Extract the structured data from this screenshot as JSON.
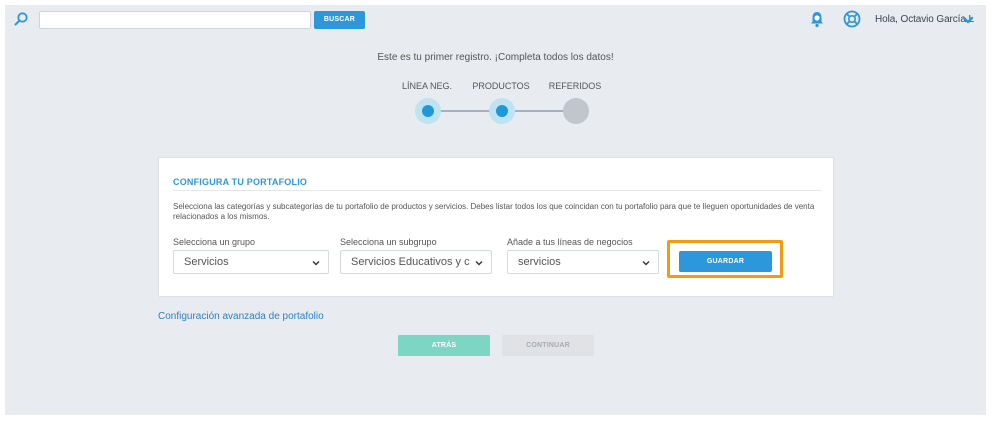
{
  "topbar": {
    "search_placeholder": "",
    "search_button": "BUSCAR",
    "greeting": "Hola, Octavio García L",
    "icons": [
      "search-icon",
      "bell-icon",
      "help-icon",
      "chevron-down-icon"
    ]
  },
  "stepper": {
    "intro": "Este es tu primer registro. ¡Completa todos los datos!",
    "steps": [
      {
        "label": "LÍNEA NEG.",
        "state": "active"
      },
      {
        "label": "PRODUCTOS",
        "state": "active"
      },
      {
        "label": "REFERIDOS",
        "state": "inactive"
      }
    ]
  },
  "panel": {
    "title": "CONFIGURA TU PORTAFOLIO",
    "description": "Selecciona las categorías y subcategorías de tu portafolio de productos y servicios. Debes listar todos los que coincidan con tu portafolio para que te lleguen oportunidades de venta relacionados a los mismos.",
    "fields": [
      {
        "label": "Selecciona un grupo",
        "value": "Servicios"
      },
      {
        "label": "Selecciona un subgrupo",
        "value": "Servicios Educativos y c"
      },
      {
        "label": "Añade a tus líneas de negocios",
        "value": "servicios"
      }
    ],
    "save_button": "GUARDAR"
  },
  "advanced_link": "Configuración avanzada de portafolio",
  "nav": {
    "back": "ATRÁS",
    "continue": "CONTINUAR"
  },
  "colors": {
    "accent": "#2d97dc",
    "highlight": "#f39a14",
    "back_button": "#7dd5c4",
    "background": "#e8ebf0"
  }
}
